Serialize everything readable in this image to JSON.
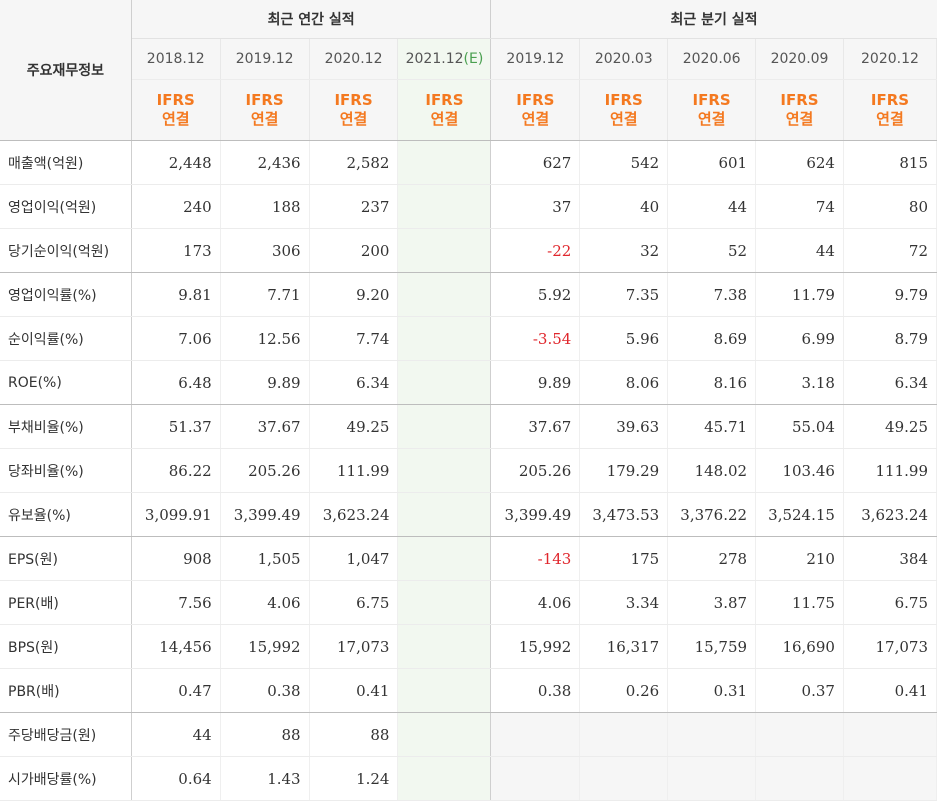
{
  "header": {
    "label": "주요재무정보",
    "annual_title": "최근 연간 실적",
    "quarter_title": "최근 분기 실적"
  },
  "periods": [
    "2018.12",
    "2019.12",
    "2020.12",
    "2021.12",
    "2019.12",
    "2020.03",
    "2020.06",
    "2020.09",
    "2020.12"
  ],
  "estimate_suffix": "(E)",
  "ifrs_top": "IFRS",
  "ifrs_bottom": "연결",
  "rows": [
    {
      "label": "매출액(억원)",
      "values": [
        "2,448",
        "2,436",
        "2,582",
        "",
        "627",
        "542",
        "601",
        "624",
        "815"
      ]
    },
    {
      "label": "영업이익(억원)",
      "values": [
        "240",
        "188",
        "237",
        "",
        "37",
        "40",
        "44",
        "74",
        "80"
      ]
    },
    {
      "label": "당기순이익(억원)",
      "values": [
        "173",
        "306",
        "200",
        "",
        "-22",
        "32",
        "52",
        "44",
        "72"
      ]
    },
    {
      "label": "영업이익률(%)",
      "values": [
        "9.81",
        "7.71",
        "9.20",
        "",
        "5.92",
        "7.35",
        "7.38",
        "11.79",
        "9.79"
      ]
    },
    {
      "label": "순이익률(%)",
      "values": [
        "7.06",
        "12.56",
        "7.74",
        "",
        "-3.54",
        "5.96",
        "8.69",
        "6.99",
        "8.79"
      ]
    },
    {
      "label": "ROE(%)",
      "values": [
        "6.48",
        "9.89",
        "6.34",
        "",
        "9.89",
        "8.06",
        "8.16",
        "3.18",
        "6.34"
      ]
    },
    {
      "label": "부채비율(%)",
      "values": [
        "51.37",
        "37.67",
        "49.25",
        "",
        "37.67",
        "39.63",
        "45.71",
        "55.04",
        "49.25"
      ]
    },
    {
      "label": "당좌비율(%)",
      "values": [
        "86.22",
        "205.26",
        "111.99",
        "",
        "205.26",
        "179.29",
        "148.02",
        "103.46",
        "111.99"
      ]
    },
    {
      "label": "유보율(%)",
      "values": [
        "3,099.91",
        "3,399.49",
        "3,623.24",
        "",
        "3,399.49",
        "3,473.53",
        "3,376.22",
        "3,524.15",
        "3,623.24"
      ]
    },
    {
      "label": "EPS(원)",
      "values": [
        "908",
        "1,505",
        "1,047",
        "",
        "-143",
        "175",
        "278",
        "210",
        "384"
      ]
    },
    {
      "label": "PER(배)",
      "values": [
        "7.56",
        "4.06",
        "6.75",
        "",
        "4.06",
        "3.34",
        "3.87",
        "11.75",
        "6.75"
      ]
    },
    {
      "label": "BPS(원)",
      "values": [
        "14,456",
        "15,992",
        "17,073",
        "",
        "15,992",
        "16,317",
        "15,759",
        "16,690",
        "17,073"
      ]
    },
    {
      "label": "PBR(배)",
      "values": [
        "0.47",
        "0.38",
        "0.41",
        "",
        "0.38",
        "0.26",
        "0.31",
        "0.37",
        "0.41"
      ]
    },
    {
      "label": "주당배당금(원)",
      "values": [
        "44",
        "88",
        "88",
        "",
        "",
        "",
        "",
        "",
        ""
      ]
    },
    {
      "label": "시가배당률(%)",
      "values": [
        "0.64",
        "1.43",
        "1.24",
        "",
        "",
        "",
        "",
        "",
        ""
      ]
    }
  ]
}
